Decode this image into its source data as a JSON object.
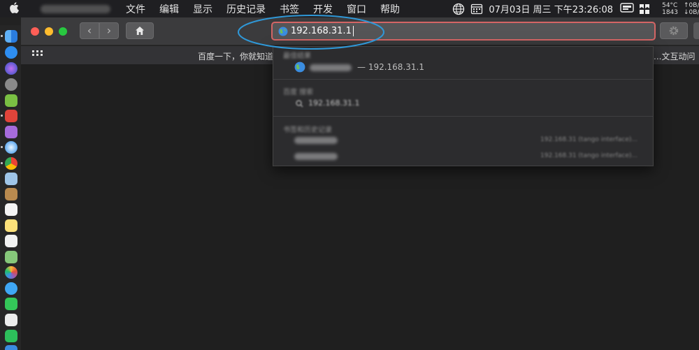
{
  "menubar": {
    "apple": "",
    "menus": [
      "文件",
      "编辑",
      "显示",
      "历史记录",
      "书签",
      "开发",
      "窗口",
      "帮助"
    ],
    "clock": "07月03日 周三 下午23:26:08",
    "cpu_temp": "54°C",
    "fan_rpm": "1843",
    "net_up": "↑0B/",
    "net_down": "↓0B/"
  },
  "browser": {
    "address_value": "192.168.31.1",
    "favorites_left": "百度一下，你就知道",
    "favorites_right": "...文互动问"
  },
  "dropdown": {
    "section_top_hit": "最佳结果",
    "top_hit_url": "— 192.168.31.1",
    "section_search": "百度 搜索",
    "search_query": "192.168.31.1",
    "section_history": "书签和历史记录",
    "history_right_1": "192.168.31 (tango interface)...",
    "history_right_2": "192.168.31 (tango interface)..."
  },
  "colors": {
    "address_border": "#d46565",
    "annotation": "#2f98d8",
    "close": "#ff5f57",
    "minimize": "#febc2e",
    "zoom": "#28c840"
  }
}
